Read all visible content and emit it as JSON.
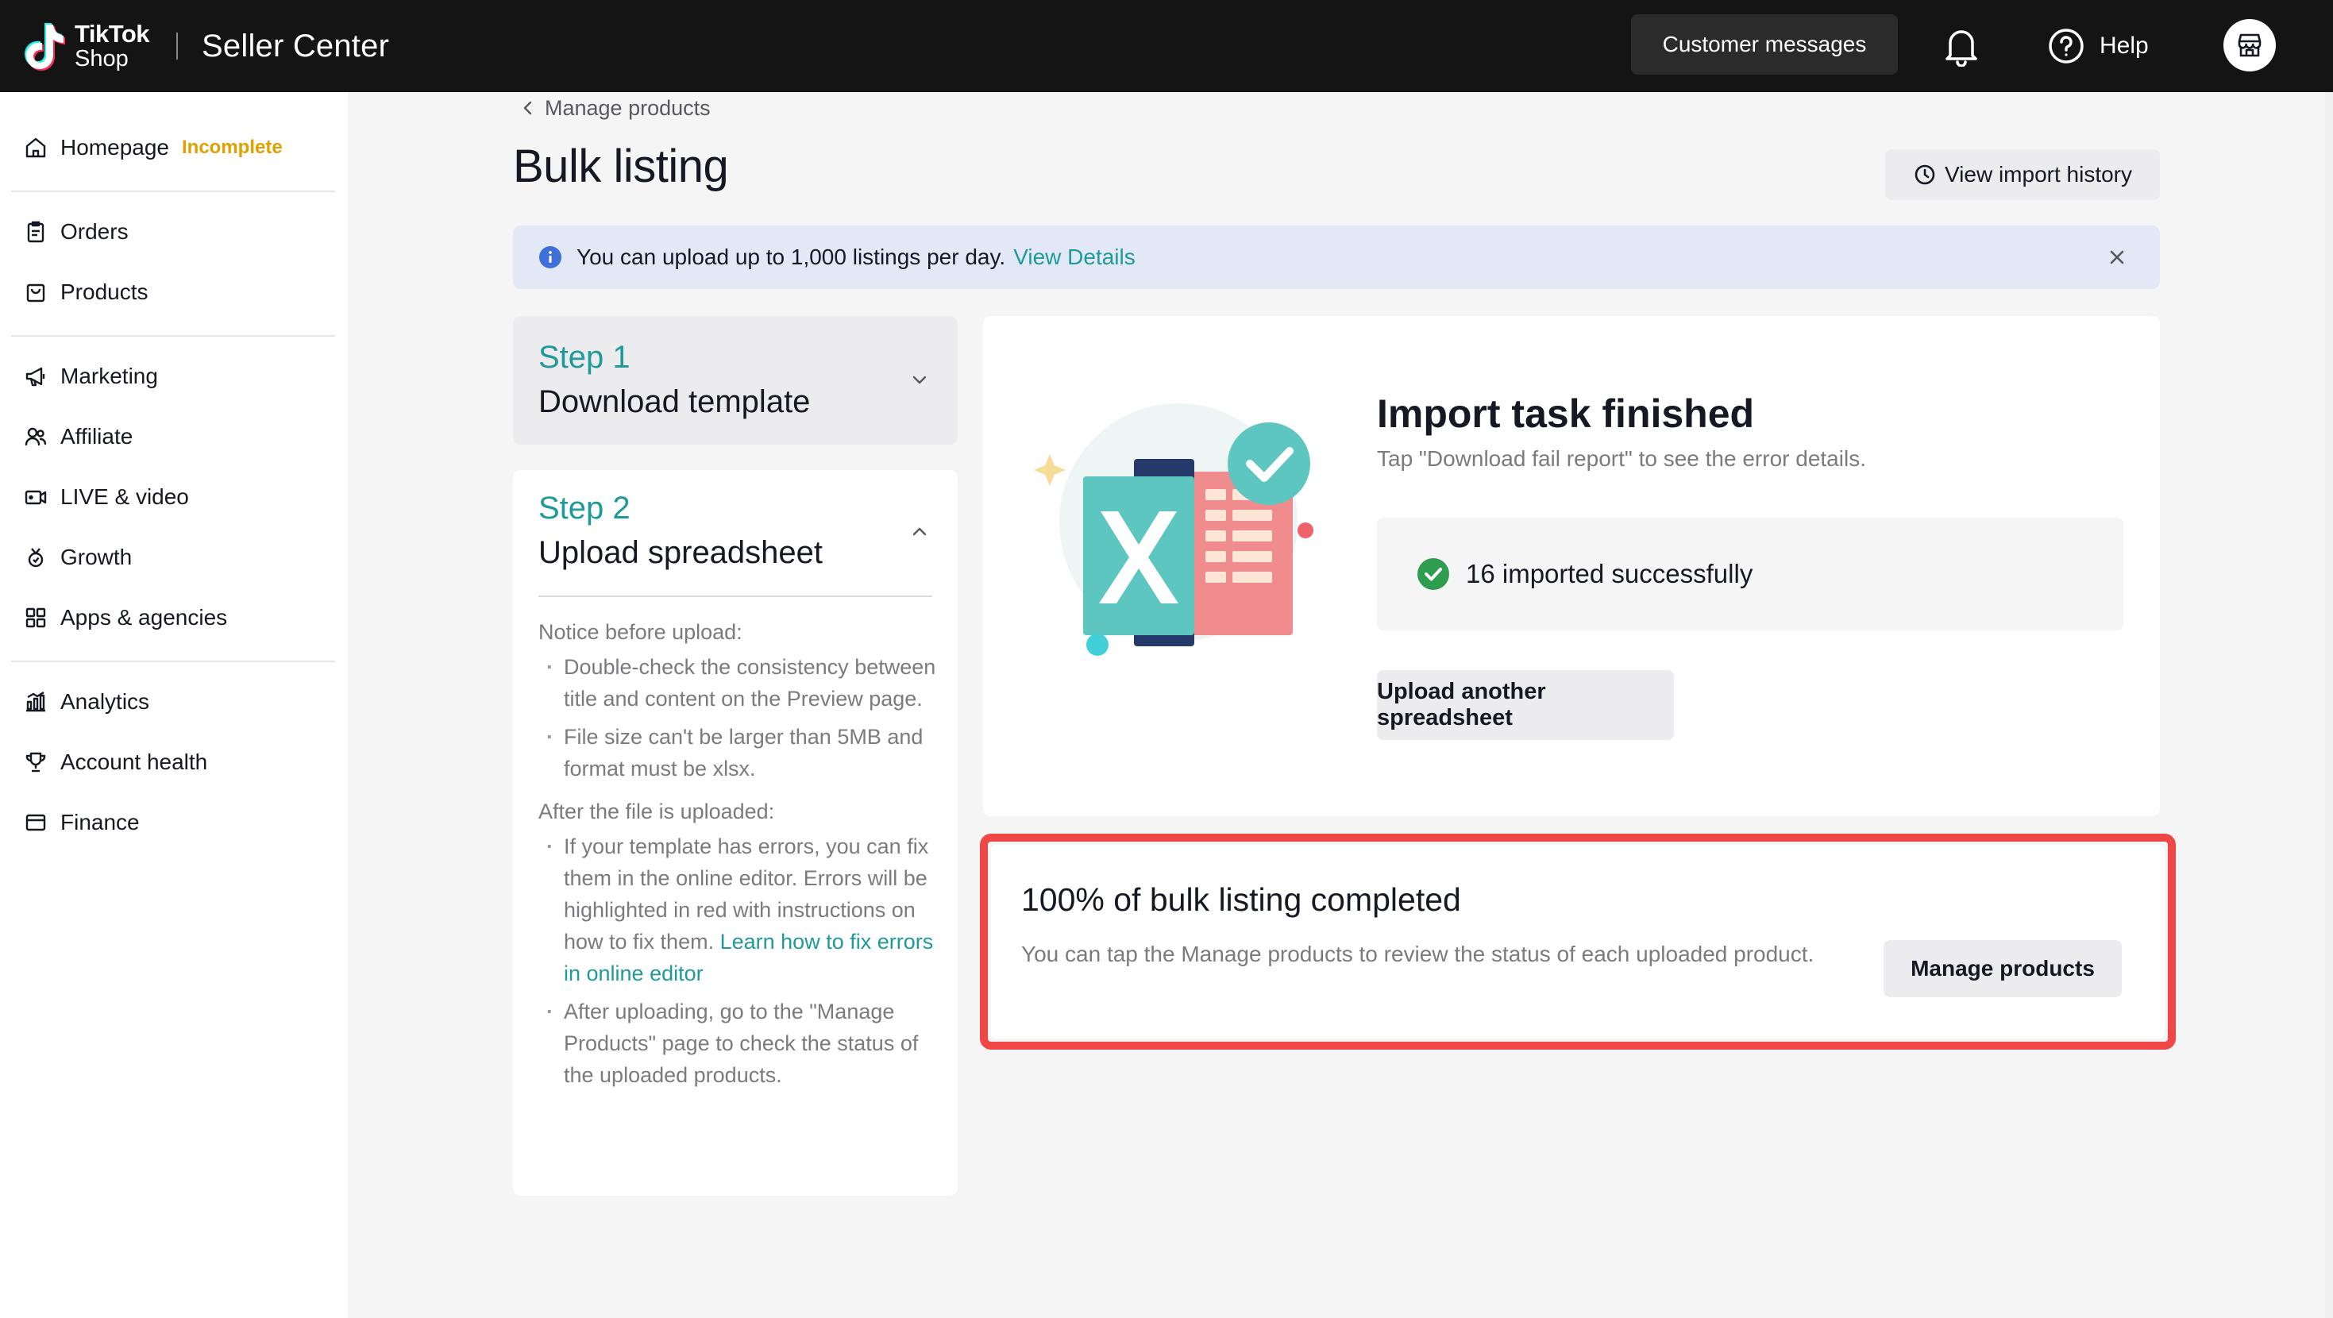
{
  "header": {
    "brand_line1": "TikTok",
    "brand_line2": "Shop",
    "app_title": "Seller Center",
    "customer_messages": "Customer messages",
    "help": "Help"
  },
  "sidebar": {
    "items": [
      {
        "label": "Homepage",
        "icon": "home-icon",
        "badge": "Incomplete"
      },
      {
        "label": "Orders",
        "icon": "clipboard-icon"
      },
      {
        "label": "Products",
        "icon": "bag-icon"
      },
      {
        "label": "Marketing",
        "icon": "megaphone-icon"
      },
      {
        "label": "Affiliate",
        "icon": "people-icon"
      },
      {
        "label": "LIVE & video",
        "icon": "video-icon"
      },
      {
        "label": "Growth",
        "icon": "medal-icon"
      },
      {
        "label": "Apps & agencies",
        "icon": "apps-icon"
      },
      {
        "label": "Analytics",
        "icon": "chart-icon"
      },
      {
        "label": "Account health",
        "icon": "trophy-icon"
      },
      {
        "label": "Finance",
        "icon": "wallet-icon"
      }
    ]
  },
  "breadcrumb": "Manage products",
  "page_title": "Bulk listing",
  "view_import_history": "View import history",
  "notice": {
    "text": "You can upload up to 1,000 listings per day.",
    "link": "View Details"
  },
  "step1": {
    "number": "Step 1",
    "title": "Download template"
  },
  "step2": {
    "number": "Step 2",
    "title": "Upload spreadsheet",
    "before_heading": "Notice before upload:",
    "before_items": [
      "Double-check the consistency between title and content on the Preview page.",
      "File size can't be larger than 5MB and format must be xlsx."
    ],
    "after_heading": "After the file is uploaded:",
    "after_item1": "If your template has errors, you can fix them in the online editor. Errors will be highlighted in red with instructions on how to fix them.",
    "after_item1_link": "Learn how to fix errors in online editor",
    "after_item2": "After uploading, go to the \"Manage Products\" page to check the status of the uploaded products."
  },
  "result": {
    "title": "Import task finished",
    "subtitle": "Tap \"Download fail report\" to see the error details.",
    "success_text": "16 imported successfully",
    "upload_another": "Upload another spreadsheet"
  },
  "completion": {
    "title": "100% of bulk listing completed",
    "subtitle": "You can tap the Manage products to review the status of each uploaded product.",
    "manage_button": "Manage products"
  },
  "colors": {
    "teal_accent": "#1f9a9a",
    "badge_amber": "#e0a100",
    "highlight_red": "#ef4646",
    "success_green": "#2e9d4f"
  }
}
